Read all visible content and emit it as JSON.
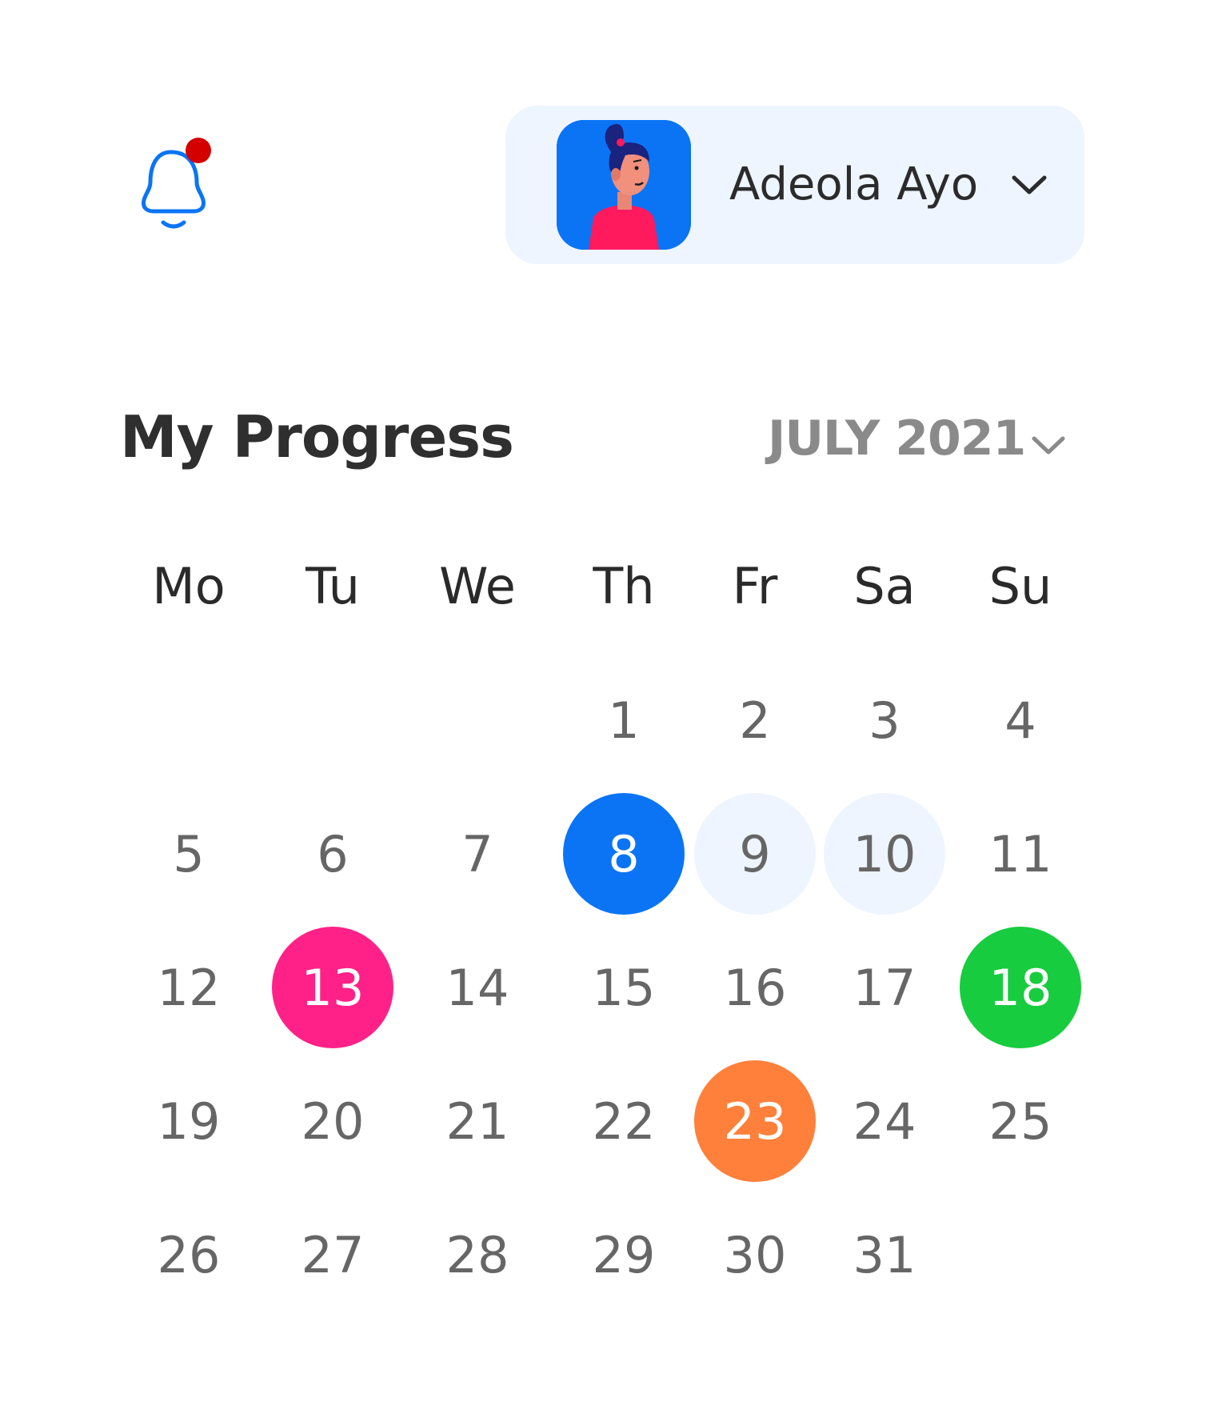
{
  "header": {
    "notification_icon": "bell-icon",
    "notification_badge_color": "#d40000",
    "user": {
      "name": "Adeola Ayo",
      "avatar_icon": "user-avatar",
      "dropdown_icon": "chevron-down-icon"
    }
  },
  "progress": {
    "title": "My Progress",
    "month": "JULY 2021",
    "month_dropdown_icon": "chevron-down-icon"
  },
  "calendar": {
    "weekdays": [
      "Mo",
      "Tu",
      "We",
      "Th",
      "Fr",
      "Sa",
      "Su"
    ],
    "first_weekday_index": 3,
    "days_in_month": 31,
    "highlights": {
      "8": "#0a74f5",
      "9": "#eef5ff",
      "10": "#eef5ff",
      "13": "#ff2187",
      "18": "#17cc3f",
      "23": "#ff803b"
    }
  },
  "colors": {
    "accent_blue": "#0a74f5",
    "light_blue": "#eef5ff",
    "pink": "#ff2187",
    "green": "#17cc3f",
    "orange": "#ff803b",
    "text_dark": "#2f2f2f",
    "text_muted": "#666666"
  }
}
